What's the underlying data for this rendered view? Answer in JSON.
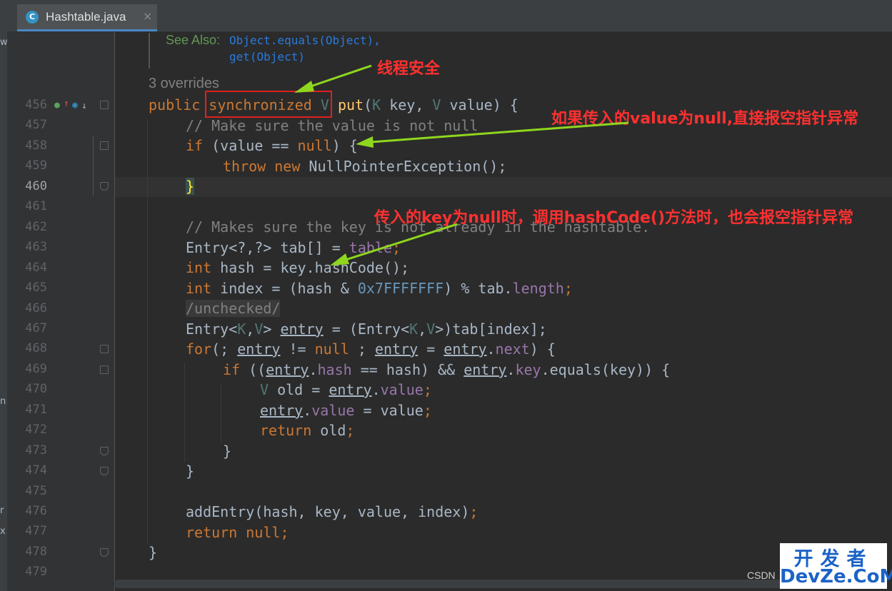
{
  "tab": {
    "icon": "C",
    "name": "Hashtable.java",
    "close": "×"
  },
  "doc": {
    "see_also": "See Also:",
    "link1": "Object.equals(Object),",
    "link2": "get(Object)"
  },
  "overrides": "3 overrides",
  "line_numbers": [
    "456",
    "457",
    "458",
    "459",
    "460",
    "461",
    "462",
    "463",
    "464",
    "465",
    "466",
    "467",
    "468",
    "469",
    "470",
    "471",
    "472",
    "473",
    "474",
    "475",
    "476",
    "477",
    "478",
    "479"
  ],
  "current_line": "460",
  "annotations": {
    "thread_safe": "线程安全",
    "value_null": "如果传入的value为null,直接报空指针异常",
    "key_null": "传入的key为null时，调用hashCode()方法时，也会报空指针异常"
  },
  "code": {
    "l456": {
      "public": "public",
      "sync": "synchronized",
      "v": "V",
      "put": "put",
      "p1": "(",
      "k": "K",
      "key": " key, ",
      "v2": "V",
      "rest": " value) {"
    },
    "l457": "// Make sure the value is not null",
    "l458": {
      "if": "if",
      "mid": " (value == ",
      "null": "null",
      "end": ") {"
    },
    "l459": {
      "throw": "throw",
      "new": "new",
      "rest": " NullPointerException();"
    },
    "l460": "}",
    "l462": "// Makes sure the key is not already in the hashtable.",
    "l463": {
      "a": "Entry<?,?> tab[] = ",
      "fld": "table",
      "end": ";"
    },
    "l464": {
      "int": "int",
      "a": " hash = key.hashCode();"
    },
    "l465": {
      "int": "int",
      "a": " index = (hash & ",
      "num": "0x7FFFFFFF",
      "b": ") % tab.",
      "fld": "length",
      "end": ";"
    },
    "l466": "/unchecked/",
    "l467": {
      "a": "Entry<",
      "k": "K",
      "c": ",",
      "v": "V",
      "b": "> ",
      "entry": "entry",
      "d": " = (Entry<",
      "k2": "K",
      "c2": ",",
      "v2": "V",
      "e": ">)tab[index];"
    },
    "l468": {
      "for": "for",
      "a": "(; ",
      "e1": "entry",
      "b": " != ",
      "null": "null",
      "c": " ; ",
      "e2": "entry",
      "d": " = ",
      "e3": "entry",
      "dot": ".",
      "next": "next",
      "end": ") {"
    },
    "l469": {
      "if": "if",
      "a": " ((",
      "e1": "entry",
      "dot": ".",
      "hash": "hash",
      "b": " == hash) && ",
      "e2": "entry",
      "dot2": ".",
      "key": "key",
      "c": ".equals(key)) {"
    },
    "l470": {
      "v": "V",
      "a": " old = ",
      "entry": "entry",
      "dot": ".",
      "value": "value",
      "end": ";"
    },
    "l471": {
      "entry": "entry",
      "dot": ".",
      "value": "value",
      "a": " = value",
      "end": ";"
    },
    "l472": {
      "return": "return",
      "a": " old",
      "end": ";"
    },
    "l473": "}",
    "l474": "}",
    "l476": {
      "a": "addEntry(hash, key, value, index)",
      "end": ";"
    },
    "l477": {
      "return": "return",
      "null": "null",
      "end": ";"
    },
    "l478": "}"
  },
  "watermark": {
    "csdn": "CSDN",
    "line1": "开发者",
    "line2": "DevZe.CoM"
  },
  "left_fragments": [
    "w",
    "n",
    "r",
    "x"
  ],
  "colors": {
    "keyword": "#cc7832",
    "comment": "#808080",
    "annotation": "#ff3030",
    "arrow": "#8fd61e"
  }
}
